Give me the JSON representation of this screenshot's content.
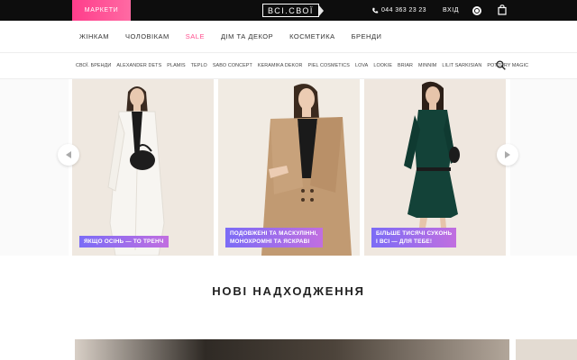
{
  "topbar": {
    "markets_label": "МАРКЕТИ",
    "logo_text": "ВСІ.СВОЇ",
    "phone": "044 363 23 23",
    "login_label": "ВХІД"
  },
  "main_nav": {
    "items": [
      {
        "label": "ЖІНКАМ"
      },
      {
        "label": "ЧОЛОВІКАМ"
      },
      {
        "label": "SALE"
      },
      {
        "label": "ДІМ ТА ДЕКОР"
      },
      {
        "label": "КОСМЕТИКА"
      },
      {
        "label": "БРЕНДИ"
      }
    ]
  },
  "brands": {
    "items": [
      "СВОЇ. БРЕНДИ",
      "ALEXANDER DETS",
      "PLAMIS",
      "TEPLO",
      "SABO CONCEPT",
      "KERAMIKA DEKOR",
      "PIEL COSMETICS",
      "LOVA",
      "LOOKIE",
      "BRIAR",
      "MINNIM",
      "LILIT SARKISIAN",
      "POTTERY MAGIC"
    ]
  },
  "carousel": {
    "slides": [
      {
        "caption_lines": [
          "ЯКЩО ОСІНЬ — ТО ТРЕНЧ"
        ]
      },
      {
        "caption_lines": [
          "ПОДОВЖЕНІ ТА МАСКУЛІННІ,",
          "МОНОХРОМНІ ТА ЯСКРАВІ"
        ]
      },
      {
        "caption_lines": [
          "БІЛЬШЕ ТИСЯЧІ СУКОНЬ",
          "І ВСІ — ДЛЯ ТЕБЕ!"
        ]
      }
    ]
  },
  "new_arrivals": {
    "title": "НОВІ НАДХОДЖЕННЯ"
  },
  "colors": {
    "accent_pink": "#ff4d8d",
    "tag_gradient_start": "#7b6cf6",
    "tag_gradient_end": "#c16ee0",
    "topbar_bg": "#0d0d0d"
  },
  "icons": [
    "phone-icon",
    "account-icon",
    "cart-icon",
    "search-icon",
    "arrow-left-icon",
    "arrow-right-icon"
  ]
}
